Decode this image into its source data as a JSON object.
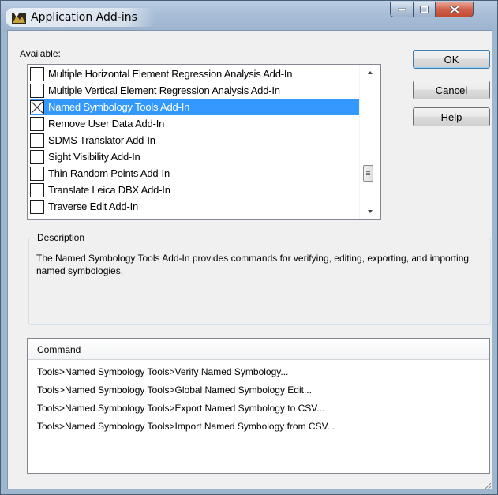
{
  "window": {
    "title": "Application Add-ins",
    "controls": [
      "minimize",
      "maximize",
      "close"
    ]
  },
  "available": {
    "label_prefix": "A",
    "label_rest": "vailable:",
    "items": [
      {
        "label": "Multiple Horizontal Element Regression Analysis Add-In",
        "checked": false,
        "selected": false
      },
      {
        "label": "Multiple Vertical Element Regression Analysis Add-In",
        "checked": false,
        "selected": false
      },
      {
        "label": "Named Symbology Tools Add-In",
        "checked": true,
        "selected": true
      },
      {
        "label": "Remove User Data Add-In",
        "checked": false,
        "selected": false
      },
      {
        "label": "SDMS Translator Add-In",
        "checked": false,
        "selected": false
      },
      {
        "label": "Sight Visibility Add-In",
        "checked": false,
        "selected": false
      },
      {
        "label": "Thin Random Points Add-In",
        "checked": false,
        "selected": false
      },
      {
        "label": "Translate Leica DBX Add-In",
        "checked": false,
        "selected": false
      },
      {
        "label": "Traverse Edit Add-In",
        "checked": false,
        "selected": false
      }
    ]
  },
  "buttons": {
    "ok": "OK",
    "cancel": "Cancel",
    "help_prefix": "H",
    "help_rest": "elp"
  },
  "description": {
    "legend": "Description",
    "text": "The Named Symbology Tools Add-In provides commands for verifying, editing, exporting, and importing named symbologies."
  },
  "commands": {
    "header": "Command",
    "rows": [
      "Tools>Named Symbology Tools>Verify Named Symbology...",
      "Tools>Named Symbology Tools>Global Named Symbology Edit...",
      "Tools>Named Symbology Tools>Export Named Symbology to CSV...",
      "Tools>Named Symbology Tools>Import Named Symbology from CSV..."
    ]
  },
  "colors": {
    "selection": "#3399ff",
    "title_bar": "#a9bfd8",
    "close_button": "#c9553c",
    "dialog_face": "#f0f0f0"
  }
}
